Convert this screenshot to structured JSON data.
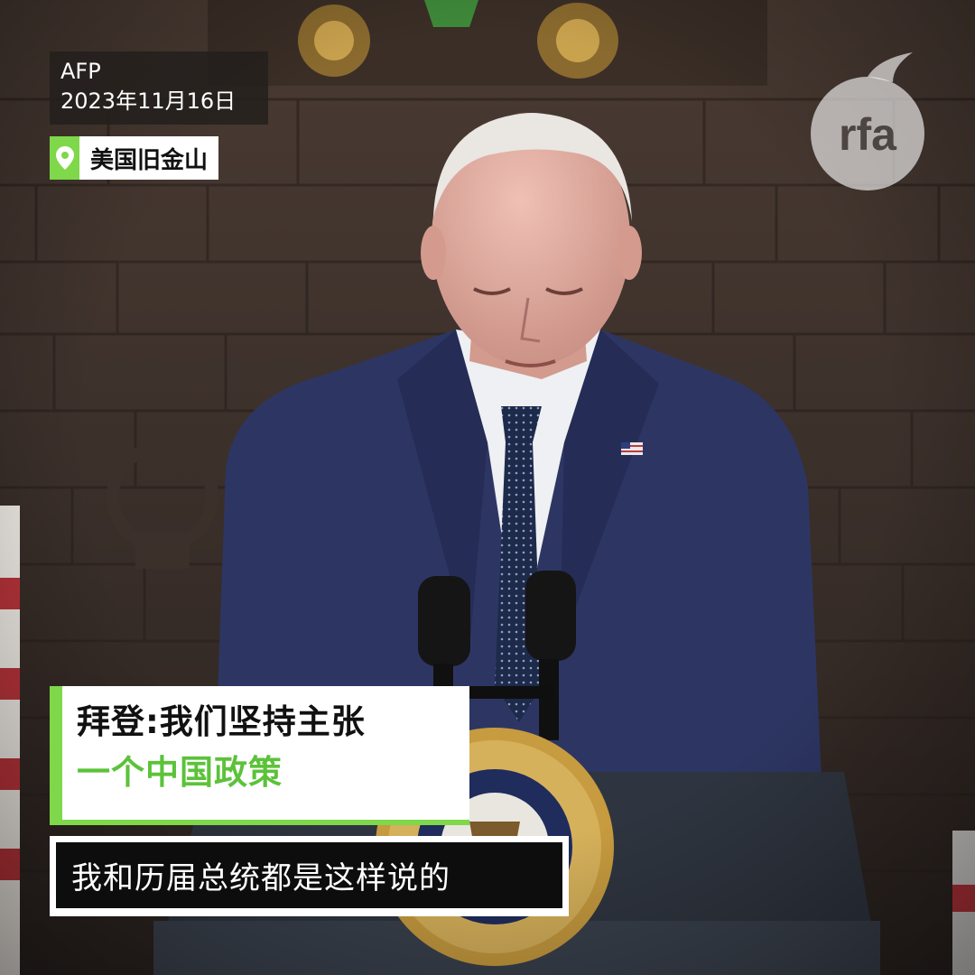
{
  "source_card": {
    "agency": "AFP",
    "date": "2023年11月16日"
  },
  "location": {
    "icon": "location-pin-icon",
    "name": "美国旧金山"
  },
  "logo": {
    "text": "rfa"
  },
  "headline": {
    "line1": "拜登:我们坚持主张",
    "line2": "一个中国政策"
  },
  "subtitle": {
    "text": "我和历届总统都是这样说的"
  },
  "colors": {
    "accent_green": "#7ed84a",
    "headline_green": "#5cc23a"
  }
}
